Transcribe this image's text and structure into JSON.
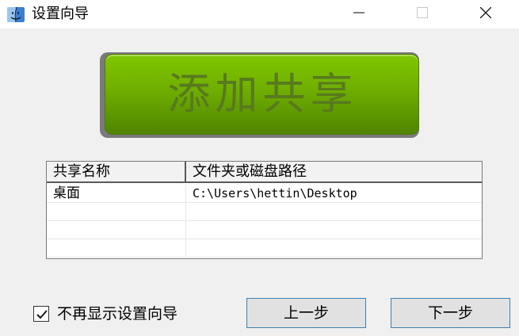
{
  "window": {
    "title": "设置向导",
    "minimize_icon": "minimize-icon",
    "maximize_icon": "maximize-icon",
    "close_icon": "close-icon",
    "app_icon": "mac-finder-icon"
  },
  "main_action": {
    "label": "添加共享",
    "accent": "#6fae00"
  },
  "share_table": {
    "columns": [
      "共享名称",
      "文件夹或磁盘路径"
    ],
    "rows": [
      [
        "桌面",
        "C:\\Users\\hettin\\Desktop"
      ],
      [
        "",
        ""
      ],
      [
        "",
        ""
      ],
      [
        "",
        ""
      ]
    ]
  },
  "footer": {
    "dont_show_label": "不再显示设置向导",
    "dont_show_checked": true,
    "prev_label": "上一步",
    "next_label": "下一步"
  }
}
